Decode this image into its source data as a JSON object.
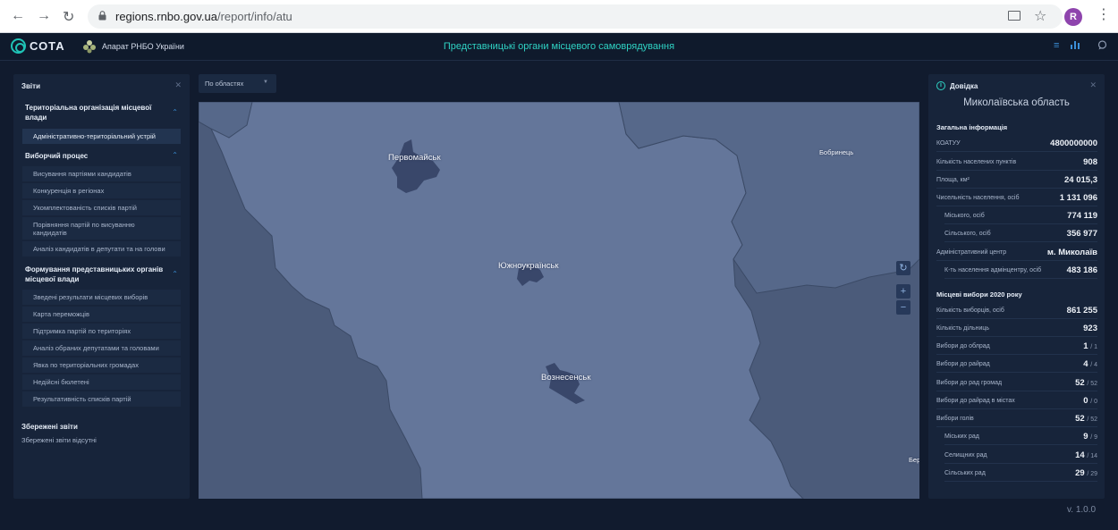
{
  "browser": {
    "url_host": "regions.rnbo.gov.ua",
    "url_path": "/report/info/atu",
    "avatar_letter": "R"
  },
  "header": {
    "logo_text": "СОТА",
    "org_name": "Апарат РНБО України",
    "title": "Представницькі органи місцевого самоврядування"
  },
  "left_panel": {
    "title": "Звіти",
    "sections": [
      {
        "title": "Територіальна організація місцевої влади",
        "items": [
          "Адміністративно-територіальний устрій"
        ]
      },
      {
        "title": "Виборчий процес",
        "items": [
          "Висування партіями кандидатів",
          "Конкуренція в регіонах",
          "Укомплектованість списків партій",
          "Порівняння партій по висуванню кандидатів",
          "Аналіз кандидатів в депутати та на голови"
        ]
      },
      {
        "title": "Формування представницьких органів місцевої влади",
        "items": [
          "Зведені результати місцевих виборів",
          "Карта переможців",
          "Підтримка партій по територіях",
          "Аналіз обраних депутатами та головами",
          "Явка по територіальних громадах",
          "Недійсні бюлетені",
          "Результативність списків партій"
        ]
      }
    ],
    "saved_title": "Збережені звіти",
    "saved_empty": "Збережені звіти відсутні"
  },
  "filter": {
    "selected": "По областях"
  },
  "map": {
    "cities": [
      "Первомайськ",
      "Южноукраїнськ",
      "Вознесенськ",
      "Бобринець",
      "Бер"
    ]
  },
  "right_panel": {
    "title": "Довідка",
    "region": "Миколаївська область",
    "general_title": "Загальна інформація",
    "general": [
      {
        "k": "КОАТУУ",
        "v": "4800000000"
      },
      {
        "k": "Кількість населених пунктів",
        "v": "908"
      },
      {
        "k": "Площа, км²",
        "v": "24 015,3"
      },
      {
        "k": "Чисельність населення, осіб",
        "v": "1 131 096"
      },
      {
        "k": "Міського, осіб",
        "v": "774 119"
      },
      {
        "k": "Сільського, осіб",
        "v": "356 977"
      },
      {
        "k": "Адміністративний центр",
        "v": "м. Миколаїв"
      },
      {
        "k": "К-ть населення адмінцентру, осіб",
        "v": "483 186"
      }
    ],
    "elections_title": "Місцеві вибори 2020 року",
    "elections": [
      {
        "k": "Кількість виборців, осіб",
        "v": "861 255",
        "t": ""
      },
      {
        "k": "Кількість дільниць",
        "v": "923",
        "t": ""
      },
      {
        "k": "Вибори до облрад",
        "v": "1",
        "t": "/ 1"
      },
      {
        "k": "Вибори до райрад",
        "v": "4",
        "t": "/ 4"
      },
      {
        "k": "Вибори до рад громад",
        "v": "52",
        "t": "/ 52"
      },
      {
        "k": "Вибори до райрад в містах",
        "v": "0",
        "t": "/ 0"
      },
      {
        "k": "Вибори голів",
        "v": "52",
        "t": "/ 52"
      },
      {
        "k": "Міських рад",
        "v": "9",
        "t": "/ 9"
      },
      {
        "k": "Селищних рад",
        "v": "14",
        "t": "/ 14"
      },
      {
        "k": "Сільських рад",
        "v": "29",
        "t": "/ 29"
      }
    ]
  },
  "version": "v. 1.0.0"
}
